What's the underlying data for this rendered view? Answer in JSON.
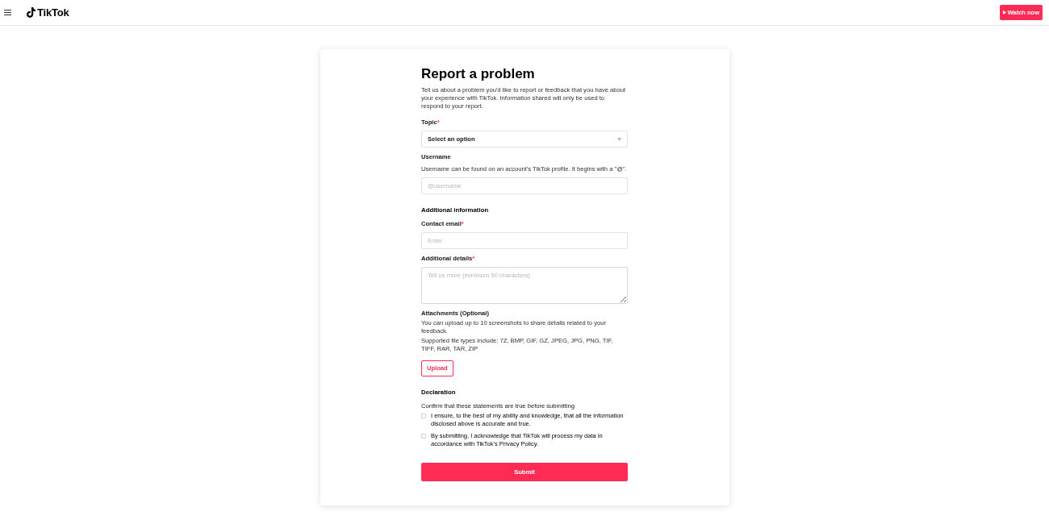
{
  "header": {
    "logo_text": "TikTok",
    "watch_button": {
      "label": "Watch now"
    }
  },
  "form": {
    "title": "Report a problem",
    "description": "Tell us about a problem you'd like to report or feedback that you have about your experience with TikTok. Information shared will only be used to respond to your report.",
    "blocks": [
      {
        "kind": "select",
        "label": "Topic",
        "required_mark": "*",
        "value": "Select an option"
      },
      {
        "kind": "input",
        "label": "Username",
        "help": "Username can be found on an account's TikTok profile. It begins with a \"@\".",
        "placeholder": "@username"
      },
      {
        "kind": "section",
        "title": "Additional information"
      },
      {
        "kind": "input",
        "label": "Contact email",
        "required_mark": "*",
        "placeholder": "Enter"
      },
      {
        "kind": "textarea",
        "label": "Additional details",
        "required_mark": "*",
        "placeholder": "Tell us more (minimum 50 characters)"
      },
      {
        "kind": "upload",
        "label": "Attachments (Optional)",
        "notes": [
          "You can upload up to 10 screenshots to share details related to your feedback.",
          "Supported file types include: 7Z, BMP, GIF, GZ, JPEG, JPG, PNG, TIF, TIFF, RAR, TAR, ZIP"
        ],
        "button": "Upload"
      },
      {
        "kind": "section",
        "title": "Declaration"
      },
      {
        "kind": "checklist",
        "intro": "Confirm that these statements are true before submitting",
        "items": [
          {
            "text": "I ensure, to the best of my ability and knowledge, that all the information disclosed above is accurate and true.",
            "checked": false
          },
          {
            "text": "By submitting, I acknowledge that TikTok will process my data in accordance with TikTok's Privacy Policy.",
            "checked": false
          }
        ]
      }
    ],
    "submit": "Submit"
  }
}
